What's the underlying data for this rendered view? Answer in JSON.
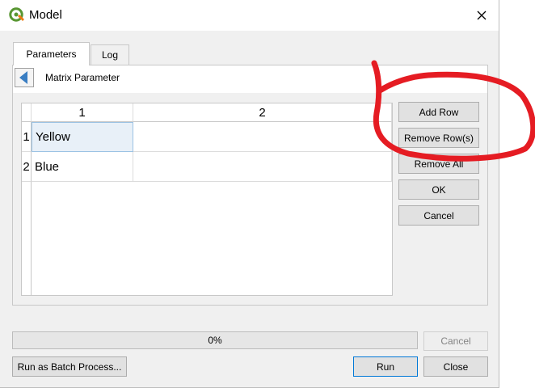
{
  "window": {
    "title": "Model",
    "close_icon": "close-icon",
    "app_icon": "qgis-logo-icon"
  },
  "tabs": [
    {
      "label": "Parameters",
      "active": true
    },
    {
      "label": "Log",
      "active": false
    }
  ],
  "breadcrumb": {
    "back_icon": "back-arrow-icon",
    "label": "Matrix Parameter"
  },
  "table": {
    "columns": [
      "1",
      "2"
    ],
    "row_numbers": [
      "1",
      "2"
    ],
    "rows": [
      [
        "Yellow",
        ""
      ],
      [
        "Blue",
        ""
      ]
    ],
    "selected_cell": "Yellow"
  },
  "side_buttons": {
    "add_row": "Add Row",
    "remove_rows": "Remove Row(s)",
    "remove_all": "Remove All",
    "ok": "OK",
    "cancel": "Cancel"
  },
  "footer": {
    "progress_text": "0%",
    "progress_value": 0,
    "cancel": "Cancel",
    "batch": "Run as Batch Process...",
    "run": "Run",
    "close": "Close"
  },
  "colors": {
    "annotation_red": "#e51c23",
    "accent": "#0078d7",
    "qgis_green": "#589632",
    "back_arrow_blue": "#3a7ec2"
  }
}
